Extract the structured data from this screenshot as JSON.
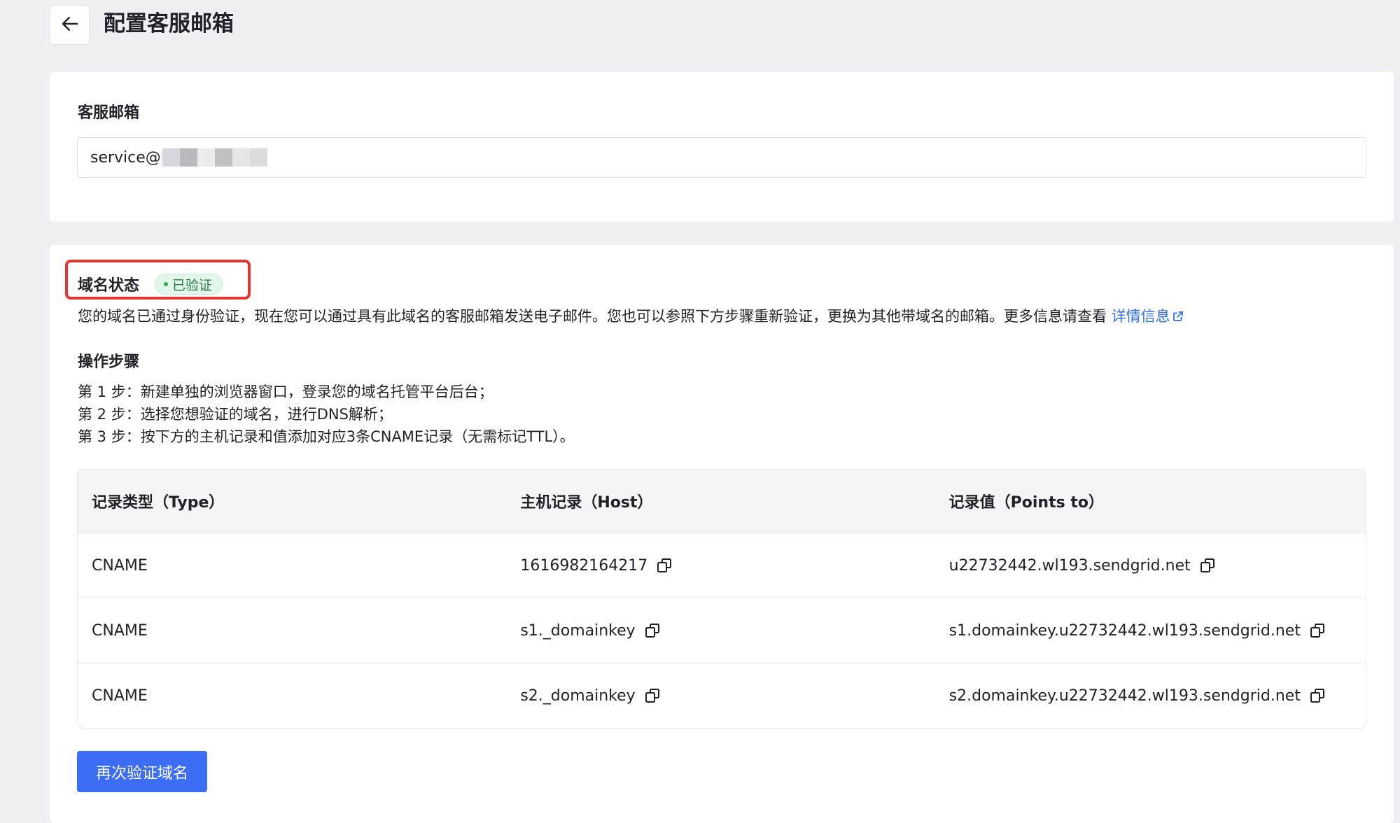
{
  "header": {
    "title": "配置客服邮箱"
  },
  "email_section": {
    "label": "客服邮箱",
    "value": "service@"
  },
  "domain_section": {
    "status_label": "域名状态",
    "status_badge": "已验证",
    "description": "您的域名已通过身份验证，现在您可以通过具有此域名的客服邮箱发送电子邮件。您也可以参照下方步骤重新验证，更换为其他带域名的邮箱。更多信息请查看 ",
    "details_link": "详情信息",
    "steps_title": "操作步骤",
    "steps": [
      "第 1 步：新建单独的浏览器窗口，登录您的域名托管平台后台；",
      "第 2 步：选择您想验证的域名，进行DNS解析；",
      "第 3 步：按下方的主机记录和值添加对应3条CNAME记录（无需标记TTL）。"
    ],
    "table": {
      "headers": [
        "记录类型（Type）",
        "主机记录（Host）",
        "记录值（Points to）"
      ],
      "rows": [
        [
          "CNAME",
          "1616982164217",
          "u22732442.wl193.sendgrid.net"
        ],
        [
          "CNAME",
          "s1._domainkey",
          "s1.domainkey.u22732442.wl193.sendgrid.net"
        ],
        [
          "CNAME",
          "s2._domainkey",
          "s2.domainkey.u22732442.wl193.sendgrid.net"
        ]
      ]
    },
    "reverify_button": "再次验证域名"
  },
  "colors": {
    "primary": "#3b6ef5",
    "link": "#2f6df6",
    "success": "#34a853",
    "highlight": "#e3342f"
  },
  "icons": [
    "arrow-left-icon",
    "external-link-icon",
    "copy-icon"
  ]
}
